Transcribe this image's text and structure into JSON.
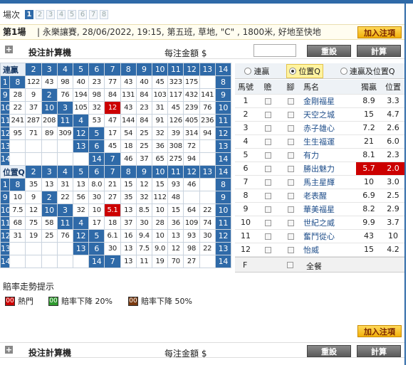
{
  "race_selector": {
    "label": "場次",
    "races": [
      "1",
      "2",
      "3",
      "4",
      "5",
      "6",
      "7",
      "8"
    ],
    "active_index": 0
  },
  "race_info": {
    "race": "第1場",
    "details": "| 永樂讓賽, 28/06/2022, 19:15, 第五班, 草地, \"C\" , 1800米, 好地至快地"
  },
  "add_bet_label": "加入注項",
  "calculator": {
    "title": "投注計算機",
    "amount_label": "每注金額 $",
    "amount_value": "",
    "reset_label": "重設",
    "calc_label": "計算"
  },
  "quinella": {
    "title": "連贏",
    "top_headers": [
      "2",
      "3",
      "4",
      "5",
      "6",
      "7",
      "8",
      "9",
      "10",
      "11",
      "12",
      "13",
      "14"
    ],
    "rows": [
      [
        "1",
        "8",
        "122",
        "43",
        "98",
        "40",
        "23",
        "77",
        "43",
        "40",
        "45",
        "323",
        "175",
        ""
      ],
      [
        "9",
        "28",
        "9",
        "2",
        "76",
        "194",
        "98",
        "84",
        "131",
        "84",
        "103",
        "117",
        "432",
        "141"
      ],
      [
        "10",
        "22",
        "37",
        "10",
        "3",
        "105",
        "32",
        "12",
        "43",
        "23",
        "31",
        "45",
        "239",
        "76"
      ],
      [
        "11",
        "241",
        "287",
        "208",
        "11",
        "4",
        "53",
        "47",
        "144",
        "84",
        "91",
        "126",
        "405",
        "236"
      ],
      [
        "12",
        "95",
        "71",
        "89",
        "309",
        "12",
        "5",
        "17",
        "54",
        "25",
        "32",
        "39",
        "314",
        "94"
      ],
      [
        "13",
        "",
        "",
        "",
        "",
        "13",
        "6",
        "45",
        "18",
        "25",
        "36",
        "308",
        "72",
        ""
      ],
      [
        "14",
        "",
        "",
        "",
        "",
        "",
        "14",
        "7",
        "46",
        "37",
        "65",
        "275",
        "94",
        ""
      ]
    ],
    "bottom_headers": [
      "8",
      "9",
      "10",
      "11",
      "12",
      "13",
      "14"
    ],
    "red": [
      [
        2,
        7
      ]
    ]
  },
  "place_q": {
    "title": "位置Q",
    "top_headers": [
      "2",
      "3",
      "4",
      "5",
      "6",
      "7",
      "8",
      "9",
      "10",
      "11",
      "12",
      "13",
      "14"
    ],
    "rows": [
      [
        "1",
        "8",
        "35",
        "13",
        "31",
        "13",
        "8.0",
        "21",
        "15",
        "12",
        "15",
        "93",
        "46",
        ""
      ],
      [
        "9",
        "10",
        "9",
        "2",
        "22",
        "56",
        "30",
        "27",
        "35",
        "32",
        "112",
        "48",
        "",
        ""
      ],
      [
        "10",
        "7.5",
        "12",
        "10",
        "3",
        "32",
        "10",
        "5.1",
        "13",
        "8.5",
        "10",
        "15",
        "64",
        "22"
      ],
      [
        "11",
        "68",
        "75",
        "58",
        "11",
        "4",
        "17",
        "18",
        "37",
        "30",
        "28",
        "36",
        "109",
        "74"
      ],
      [
        "12",
        "31",
        "19",
        "25",
        "76",
        "12",
        "5",
        "6.1",
        "16",
        "9.4",
        "10",
        "13",
        "93",
        "30"
      ],
      [
        "13",
        "",
        "",
        "",
        "",
        "13",
        "6",
        "30",
        "13",
        "7.5",
        "9.0",
        "12",
        "98",
        "22"
      ],
      [
        "14",
        "",
        "",
        "",
        "",
        "",
        "14",
        "7",
        "13",
        "11",
        "19",
        "70",
        "27",
        ""
      ]
    ],
    "bottom_headers": [
      "8",
      "9",
      "10",
      "11",
      "12",
      "13",
      "14"
    ],
    "red": [
      [
        2,
        7
      ]
    ]
  },
  "pool_tabs": [
    "連贏",
    "位置Q",
    "連贏及位置Q"
  ],
  "pool_tab_selected": 1,
  "horse_table": {
    "headers": [
      "馬號",
      "贍",
      "腳",
      "馬名",
      "獨贏",
      "位置"
    ],
    "horses": [
      {
        "no": "1",
        "name": "金剛福星",
        "win": "8.9",
        "place": "3.3"
      },
      {
        "no": "2",
        "name": "天空之城",
        "win": "15",
        "place": "4.7"
      },
      {
        "no": "3",
        "name": "赤子雄心",
        "win": "7.2",
        "place": "2.6"
      },
      {
        "no": "4",
        "name": "生生福運",
        "win": "21",
        "place": "6.0"
      },
      {
        "no": "5",
        "name": "有力",
        "win": "8.1",
        "place": "2.3"
      },
      {
        "no": "6",
        "name": "勝出魅力",
        "win": "5.7",
        "place": "2.0",
        "hot": true
      },
      {
        "no": "7",
        "name": "馬主星輝",
        "win": "10",
        "place": "3.0"
      },
      {
        "no": "8",
        "name": "老表醒",
        "win": "6.9",
        "place": "2.5"
      },
      {
        "no": "9",
        "name": "華美福星",
        "win": "8.2",
        "place": "2.9"
      },
      {
        "no": "10",
        "name": "世紀之威",
        "win": "9.9",
        "place": "3.7"
      },
      {
        "no": "11",
        "name": "奮鬥從心",
        "win": "43",
        "place": "10"
      },
      {
        "no": "12",
        "name": "怡威",
        "win": "15",
        "place": "4.2"
      }
    ],
    "field_label": "F",
    "all_label": "全餐"
  },
  "trend": {
    "title": "賠率走勢提示",
    "items": [
      {
        "box": "00",
        "label": "熱門",
        "color": "#cc0000"
      },
      {
        "box": "00",
        "label": "賠率下降 20%",
        "color": "#2e9a2e"
      },
      {
        "box": "00",
        "label": "賠率下降 50%",
        "color": "#7a3a10"
      }
    ]
  }
}
